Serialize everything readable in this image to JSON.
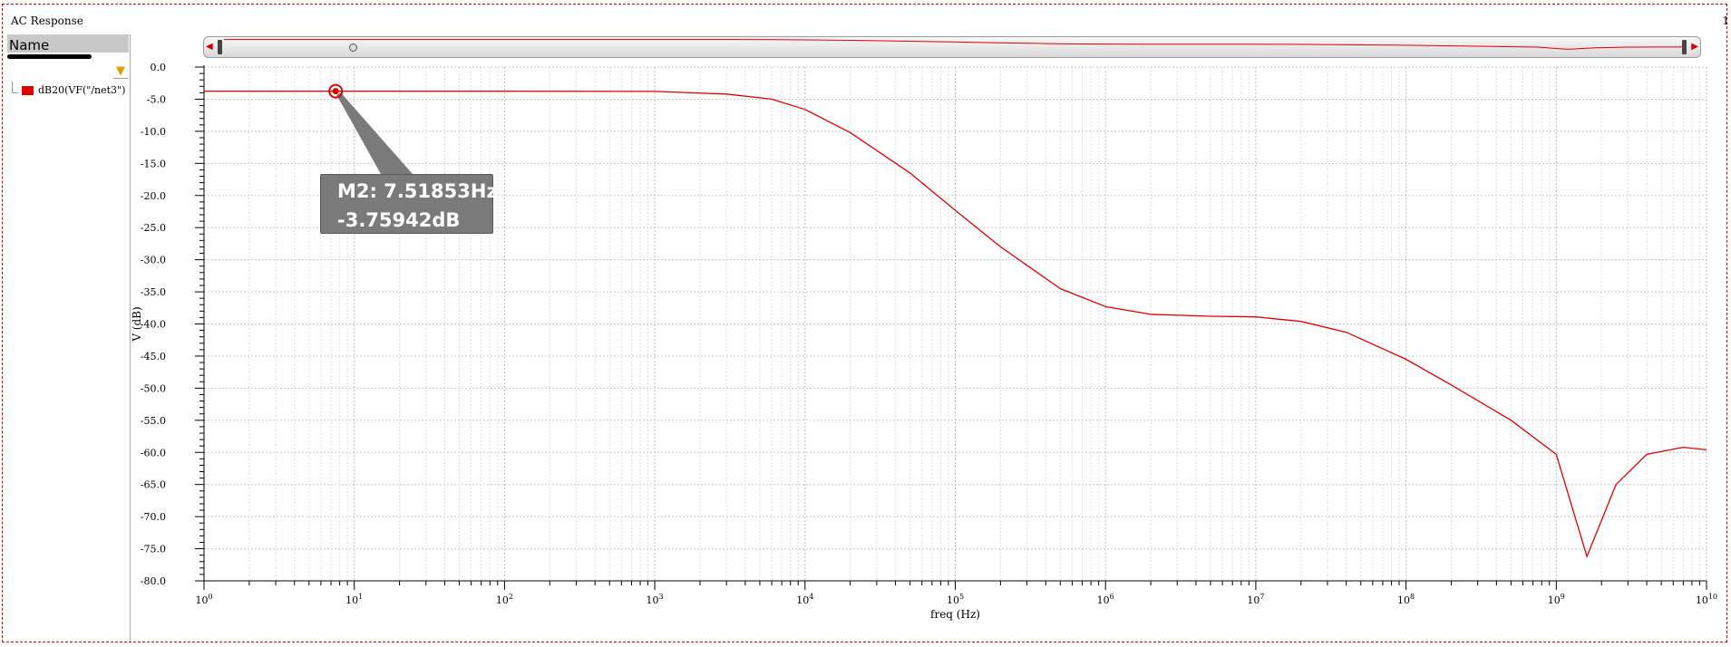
{
  "window": {
    "title": "AC Response",
    "page_number": "1"
  },
  "legend_panel": {
    "header": "Name",
    "items": [
      {
        "label": "dB20(VF(\"/net3\")",
        "color": "#e00000"
      }
    ]
  },
  "marker": {
    "line1": "M2: 7.51853Hz",
    "line2": "-3.75942dB",
    "x": 7.51853,
    "y": -3.75942
  },
  "chart_data": {
    "type": "line",
    "xlabel": "freq (Hz)",
    "ylabel": "V (dB)",
    "xscale": "log",
    "xlim": [
      1,
      10000000000
    ],
    "ylim": [
      -80,
      0
    ],
    "grid": true,
    "yticks": [
      "0.0",
      "-5.0",
      "-10.0",
      "-15.0",
      "-20.0",
      "-25.0",
      "-30.0",
      "-35.0",
      "-40.0",
      "-45.0",
      "-50.0",
      "-55.0",
      "-60.0",
      "-65.0",
      "-70.0",
      "-75.0",
      "-80.0"
    ],
    "xticks": [
      {
        "base": "10",
        "exp": "0"
      },
      {
        "base": "10",
        "exp": "1"
      },
      {
        "base": "10",
        "exp": "2"
      },
      {
        "base": "10",
        "exp": "3"
      },
      {
        "base": "10",
        "exp": "4"
      },
      {
        "base": "10",
        "exp": "5"
      },
      {
        "base": "10",
        "exp": "6"
      },
      {
        "base": "10",
        "exp": "7"
      },
      {
        "base": "10",
        "exp": "8"
      },
      {
        "base": "10",
        "exp": "9"
      },
      {
        "base": "10",
        "exp": "10"
      }
    ],
    "series": [
      {
        "name": "dB20(VF(\"/net3\")",
        "color": "#e00000",
        "x": [
          1,
          10,
          100,
          1000,
          3000,
          6000,
          10000,
          20000,
          50000,
          100000,
          200000,
          500000,
          1000000,
          2000000,
          5000000,
          10000000,
          20000000,
          40000000,
          100000000,
          200000000,
          500000000,
          1000000000,
          1600000000,
          2500000000,
          4000000000,
          7000000000,
          10000000000
        ],
        "y": [
          -3.76,
          -3.76,
          -3.76,
          -3.8,
          -4.2,
          -5.0,
          -6.6,
          -10.2,
          -16.5,
          -22.3,
          -28.0,
          -34.5,
          -37.3,
          -38.5,
          -38.8,
          -38.9,
          -39.6,
          -41.3,
          -45.5,
          -49.5,
          -55.0,
          -60.3,
          -76.2,
          -65.0,
          -60.3,
          -59.2,
          -59.6
        ]
      }
    ]
  }
}
